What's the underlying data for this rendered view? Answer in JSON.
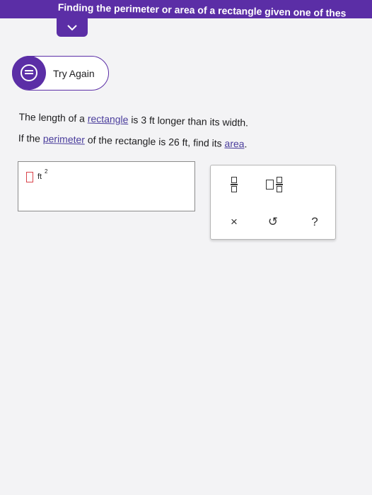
{
  "header": {
    "title": "Finding the perimeter or area of a rectangle given one of thes"
  },
  "collapse": {
    "icon": "chevron-down-icon"
  },
  "try_again": {
    "label": "Try Again",
    "icon": "retry-icon"
  },
  "problem": {
    "l1_a": "The length of a ",
    "l1_link": "rectangle",
    "l1_b": " is 3 ft longer than its width.",
    "l2_a": "If the ",
    "l2_link": "perimeter",
    "l2_b": " of the rectangle is 26 ft, find its ",
    "l2_link2": "area",
    "l2_c": "."
  },
  "answer": {
    "value": "",
    "unit": "ft",
    "exponent": "2"
  },
  "keypad": {
    "clear_label": "×",
    "undo_label": "↺",
    "help_label": "?"
  },
  "colors": {
    "accent": "#5b2ea6",
    "placeholder_border": "#d9434a"
  }
}
